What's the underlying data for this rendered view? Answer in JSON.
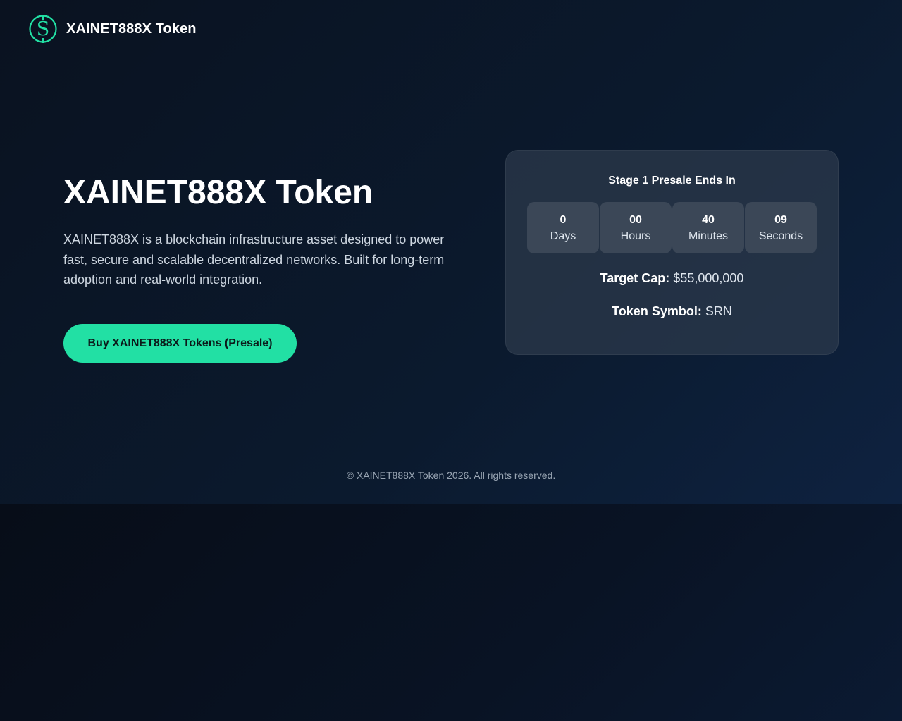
{
  "header": {
    "brand_name": "XAINET888X Token",
    "logo_icon": "dollar-circle-icon"
  },
  "hero": {
    "title": "XAINET888X Token",
    "description": "XAINET888X is a blockchain infrastructure asset designed to power fast, secure and scalable decentralized networks. Built for long-term adoption and real-world integration.",
    "buy_button_label": "Buy XAINET888X Tokens (Presale)"
  },
  "presale": {
    "title": "Stage 1 Presale Ends In",
    "countdown": [
      {
        "value": "0",
        "label": "Days"
      },
      {
        "value": "00",
        "label": "Hours"
      },
      {
        "value": "40",
        "label": "Minutes"
      },
      {
        "value": "09",
        "label": "Seconds"
      }
    ],
    "target_cap_label": "Target Cap:",
    "target_cap_value": "$55,000,000",
    "token_symbol_label": "Token Symbol:",
    "token_symbol_value": "SRN"
  },
  "footer": {
    "text": "© XAINET888X Token 2026. All rights reserved."
  },
  "colors": {
    "accent": "#22e0a4",
    "background": "#0b1a2e",
    "card": "#2d3a4c",
    "count_box": "#3b4757"
  }
}
